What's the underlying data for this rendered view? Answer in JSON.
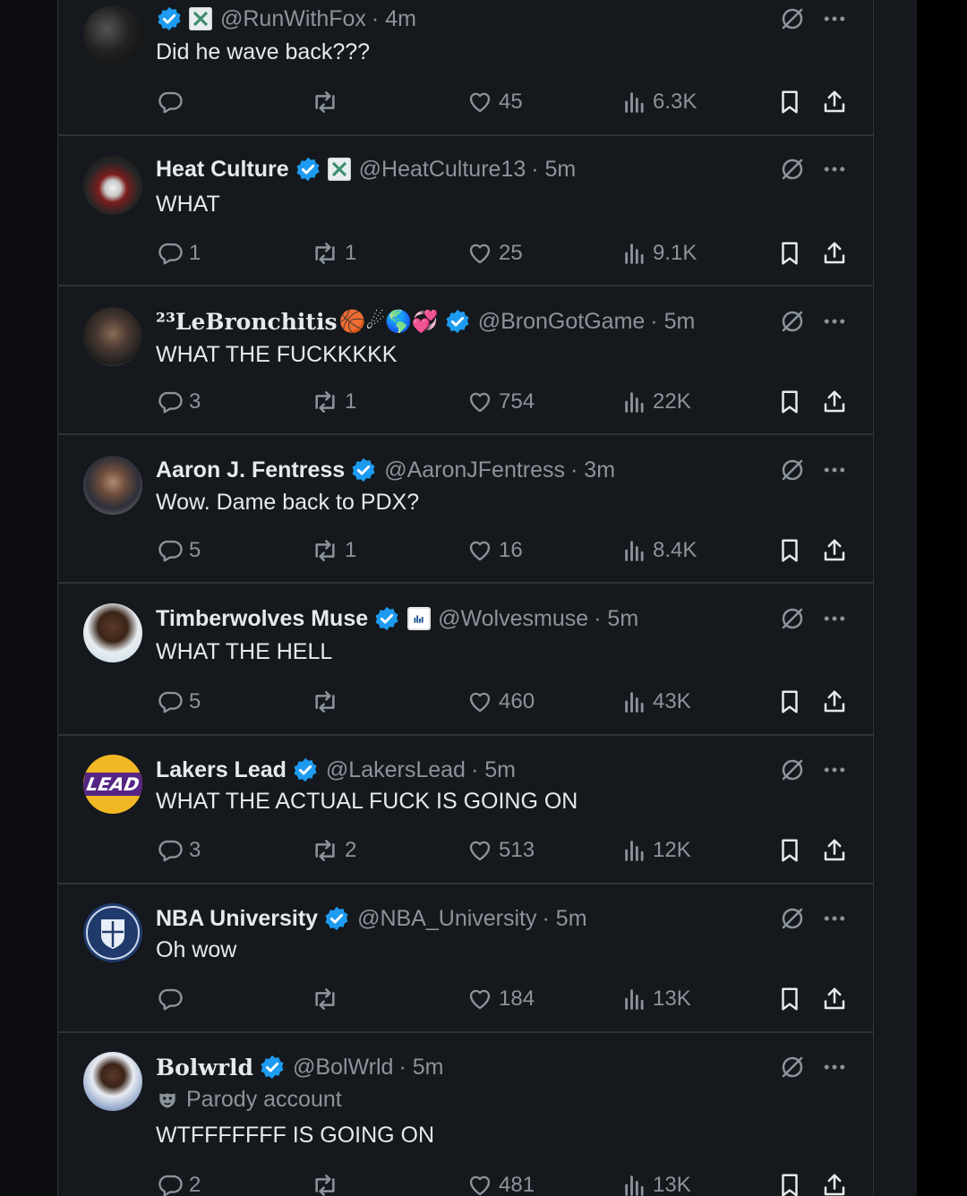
{
  "tweets": [
    {
      "name": "",
      "handle": "@RunWithFox",
      "time": "· 4m",
      "text": "Did he wave back???",
      "parody": "",
      "replies": "",
      "retweets": "",
      "likes": "45",
      "views": "6.3K"
    },
    {
      "name": "Heat Culture",
      "handle": "@HeatCulture13",
      "time": "· 5m",
      "text": "WHAT",
      "parody": "",
      "replies": "1",
      "retweets": "1",
      "likes": "25",
      "views": "9.1K"
    },
    {
      "name": "²³LeBronchitis",
      "handle": "@BronGotGame",
      "time": "· 5m",
      "text": "WHAT THE FUCKKKKK",
      "parody": "",
      "emoji": "🏀☄🌎💞",
      "replies": "3",
      "retweets": "1",
      "likes": "754",
      "views": "22K"
    },
    {
      "name": "Aaron J. Fentress",
      "handle": "@AaronJFentress",
      "time": "· 3m",
      "text": "Wow. Dame back to PDX?",
      "parody": "",
      "replies": "5",
      "retweets": "1",
      "likes": "16",
      "views": "8.4K"
    },
    {
      "name": "Timberwolves Muse",
      "handle": "@Wolvesmuse",
      "time": "· 5m",
      "text": "WHAT THE HELL",
      "parody": "",
      "replies": "5",
      "retweets": "",
      "likes": "460",
      "views": "43K"
    },
    {
      "name": "Lakers Lead",
      "handle": "@LakersLead",
      "time": "· 5m",
      "text": "WHAT THE ACTUAL FUCK IS GOING ON",
      "parody": "",
      "replies": "3",
      "retweets": "2",
      "likes": "513",
      "views": "12K"
    },
    {
      "name": "NBA University",
      "handle": "@NBA_University",
      "time": "· 5m",
      "text": "Oh wow",
      "parody": "",
      "replies": "",
      "retweets": "",
      "likes": "184",
      "views": "13K"
    },
    {
      "name": "Bolwrld",
      "handle": "@BolWrld",
      "time": "· 5m",
      "text": "WTFFFFFFF IS GOING ON",
      "parody": "Parody account",
      "replies": "2",
      "retweets": "",
      "likes": "481",
      "views": "13K"
    }
  ],
  "logos": {
    "lakers_lead": "LEAD"
  },
  "colors": {
    "background": "#15181c",
    "text": "#e7e9ea",
    "muted": "#8b949b",
    "verified": "#1d9bf0",
    "divider": "#2f3336"
  }
}
